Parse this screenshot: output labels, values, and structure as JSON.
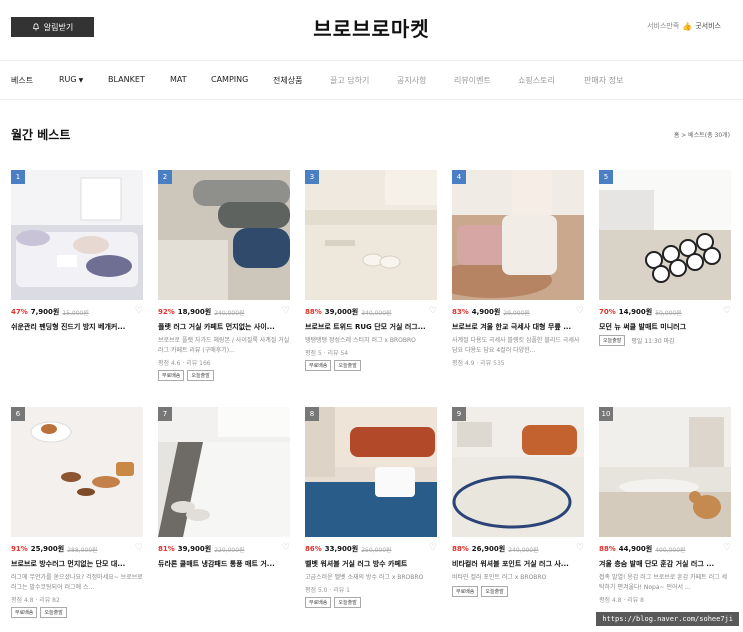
{
  "header": {
    "alarm_label": "알림받기",
    "logo": "브로브로마켓",
    "service_label": "서비스만족",
    "service_badge": "굿서비스"
  },
  "nav": {
    "items": [
      "베스트",
      "RUG",
      "BLANKET",
      "MAT",
      "CAMPING",
      "전체상품",
      "끌고 담하기",
      "공지사항",
      "리뷰이벤트",
      "쇼핑스토리",
      "판매자 정보"
    ]
  },
  "title": "월간 베스트",
  "breadcrumb": "홈 > 베스트(총 30개)",
  "colors": {
    "discount": "#e4312b",
    "rank_top": "#4a7fc4",
    "rank_other": "#777777"
  },
  "products": [
    {
      "rank": "1",
      "discount": "47%",
      "price": "7,900원",
      "orig": "15,000원",
      "name": "쉬운관리 펜딩형 진드기 방지 베개커...",
      "desc": "",
      "meta": "",
      "badges": [],
      "time": ""
    },
    {
      "rank": "2",
      "discount": "92%",
      "price": "18,900원",
      "orig": "240,000원",
      "name": "플랫 러그 거실 카페트 먼지없는 사이...",
      "desc": "브로브로 플랫 자가드 헤링본 / 사이질룩 사계절 거실 러그 카페트 리뷰 (구매후기)...",
      "meta": "평점 4.6 · 리뷰 166",
      "badges": [
        "무료배송",
        "오늘출발"
      ],
      "time": ""
    },
    {
      "rank": "3",
      "discount": "88%",
      "price": "39,000원",
      "orig": "340,000원",
      "name": "브로브로 트위드 RUG 단모 거실 러그...",
      "desc": "탱탱탱탱 정성스레 스티치 러그 x BROBRO",
      "meta": "평점 5 · 리뷰 54",
      "badges": [
        "무료배송",
        "오늘출발"
      ],
      "time": ""
    },
    {
      "rank": "4",
      "discount": "83%",
      "price": "4,900원",
      "orig": "29,000원",
      "name": "브로브로 겨울 한교 극세사 대형 무릎 ...",
      "desc": "사계절 다용도 극세사 블랭킷 심플한 블리드 극세사 담요 다용도 담요 4컬러 다양한...",
      "meta": "평점 4.9 · 리뷰 535",
      "badges": [],
      "time": ""
    },
    {
      "rank": "5",
      "discount": "70%",
      "price": "14,900원",
      "orig": "50,000원",
      "name": "모던 뉴 써클 발매트 미니러그",
      "desc": "",
      "meta": "",
      "badges": [
        "오늘출발"
      ],
      "time": "평일 11:30 마감"
    },
    {
      "rank": "6",
      "discount": "91%",
      "price": "25,900원",
      "orig": "288,000원",
      "name": "브로브로 방수러그 먼지없는 단모 대...",
      "desc": "러그에 무언가를 쏟으셨나요? 걱정마세요~ 브로브로 러그는 발수코팅되어 러그에 스...",
      "meta": "평점 4.8 · 리뷰 82",
      "badges": [
        "무료배송",
        "오늘출발"
      ],
      "time": ""
    },
    {
      "rank": "7",
      "discount": "81%",
      "price": "39,900원",
      "orig": "220,000원",
      "name": "듀라론 쿨매트 냉감패드 통풍 매트 거...",
      "desc": "",
      "meta": "",
      "badges": [],
      "time": ""
    },
    {
      "rank": "8",
      "discount": "86%",
      "price": "33,900원",
      "orig": "250,000원",
      "name": "벨벳 워셔블 거실 러그 방수 카페트",
      "desc": "고급스러운 벨벳 소재의 방수 러그 x BROBRO",
      "meta": "평점 5.0 · 리뷰 1",
      "badges": [
        "무료배송",
        "오늘출발"
      ],
      "time": ""
    },
    {
      "rank": "9",
      "discount": "88%",
      "price": "26,900원",
      "orig": "240,000원",
      "name": "비타컬러 워셔블 포인트 거실 러그 사...",
      "desc": "비타민 컬러 포인트 러그 x BROBRO",
      "meta": "",
      "badges": [
        "무료배송",
        "오늘출발"
      ],
      "time": ""
    },
    {
      "rank": "10",
      "discount": "88%",
      "price": "44,900원",
      "orig": "400,000원",
      "name": "겨울 층숨 발매 단모 훈감 거실 러그 ...",
      "desc": "접촉 발열! 옹감 러그 브로브로 훈감 카페트 러그 세탁하기 편겨울다! Nopa~ 펀어서 ...",
      "meta": "평점 4.8 · 리뷰 8",
      "badges": [],
      "time": ""
    }
  ],
  "watermark": "https://blog.naver.com/sohee7ji"
}
